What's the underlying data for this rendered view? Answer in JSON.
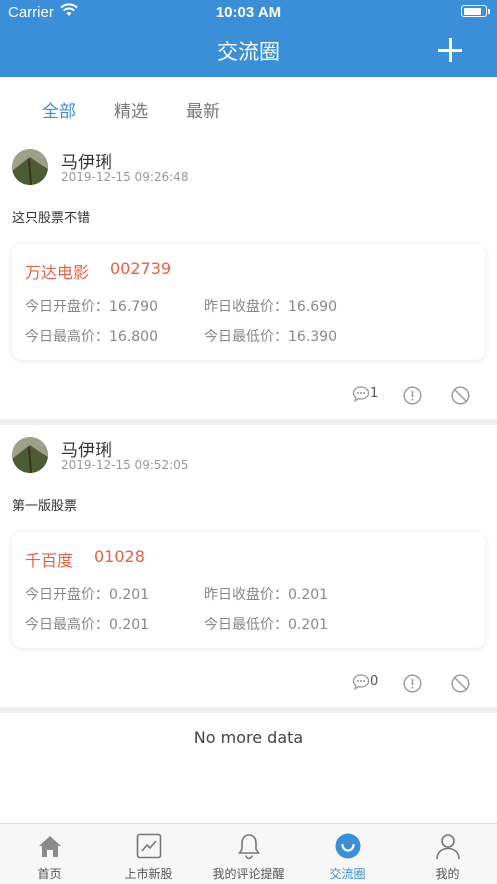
{
  "status_bar": {
    "carrier": "Carrier",
    "time": "10:03 AM"
  },
  "nav": {
    "title": "交流圈",
    "add_icon": "plus-icon"
  },
  "tabs": [
    {
      "label": "全部",
      "active": true
    },
    {
      "label": "精选",
      "active": false
    },
    {
      "label": "最新",
      "active": false
    }
  ],
  "posts": [
    {
      "user": "马伊琍",
      "time": "2019-12-15 09:26:48",
      "text": "这只股票不错",
      "stock": {
        "name": "万达电影",
        "code": "002739"
      },
      "quotes": {
        "open_label": "今日开盘价：",
        "open": "16.790",
        "prev_close_label": "昨日收盘价：",
        "prev_close": "16.690",
        "high_label": "今日最高价：",
        "high": "16.800",
        "low_label": "今日最低价：",
        "low": "16.390"
      },
      "comment_count": "1"
    },
    {
      "user": "马伊琍",
      "time": "2019-12-15 09:52:05",
      "text": "第一版股票",
      "stock": {
        "name": "千百度",
        "code": "01028"
      },
      "quotes": {
        "open_label": "今日开盘价：",
        "open": "0.201",
        "prev_close_label": "昨日收盘价：",
        "prev_close": "0.201",
        "high_label": "今日最高价：",
        "high": "0.201",
        "low_label": "今日最低价：",
        "low": "0.201"
      },
      "comment_count": "0"
    }
  ],
  "footer_text": "No more data",
  "tabbar": [
    {
      "label": "首页",
      "icon": "home-icon",
      "active": false
    },
    {
      "label": "上市新股",
      "icon": "chart-icon",
      "active": false
    },
    {
      "label": "我的评论提醒",
      "icon": "bell-icon",
      "active": false
    },
    {
      "label": "交流圈",
      "icon": "chat-circle-icon",
      "active": true
    },
    {
      "label": "我的",
      "icon": "person-icon",
      "active": false
    }
  ],
  "colors": {
    "primary": "#3a8fd8",
    "stock_red": "#e8604a",
    "divider": "#eeeeee"
  }
}
